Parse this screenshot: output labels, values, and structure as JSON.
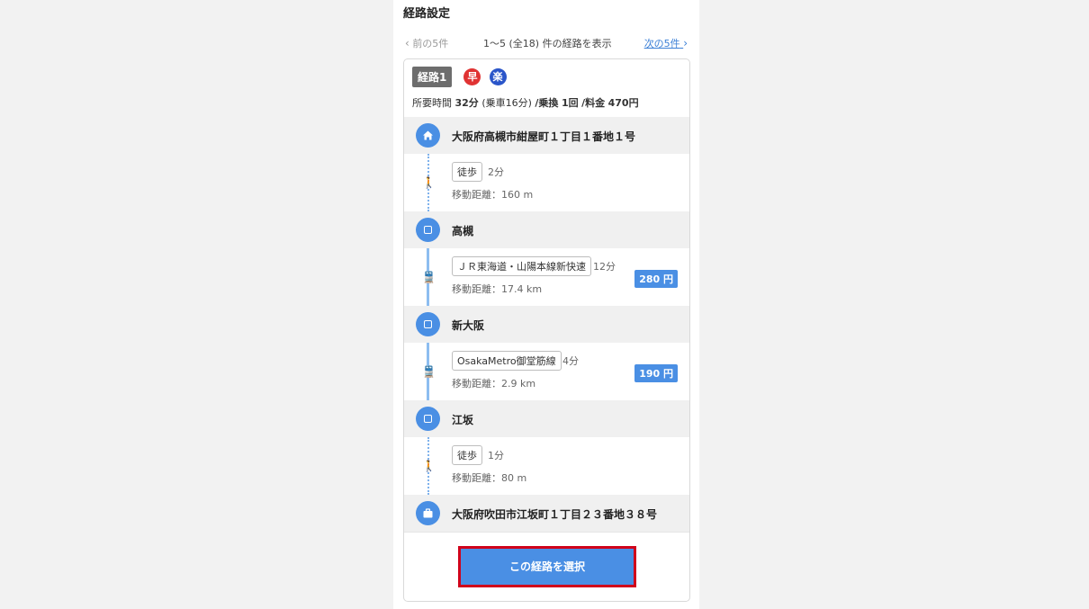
{
  "header": {
    "title": "経路設定"
  },
  "pager": {
    "prev_label": "前の5件",
    "summary": "1〜5 (全18) 件の経路を表示",
    "next_label": "次の5件"
  },
  "route": {
    "label": "経路1",
    "badges": {
      "fast": "早",
      "easy": "楽"
    },
    "summary": {
      "time_label": "所要時間",
      "time": "32分",
      "ride": "(乗車16分)",
      "transfer_label": "/乗換",
      "transfer": "1回",
      "fare_label": "/料金",
      "fare": "470円"
    }
  },
  "stations": [
    {
      "name": "大阪府高槻市紺屋町１丁目１番地１号",
      "icon": "home-icon"
    },
    {
      "name": "高槻",
      "icon": "station-icon"
    },
    {
      "name": "新大阪",
      "icon": "station-icon"
    },
    {
      "name": "江坂",
      "icon": "station-icon"
    },
    {
      "name": "大阪府吹田市江坂町１丁目２３番地３８号",
      "icon": "briefcase-icon"
    }
  ],
  "segments": [
    {
      "mode": "walk",
      "tag": "徒歩",
      "duration": "2分",
      "distance": "移動距離：160 m",
      "fare": ""
    },
    {
      "mode": "train",
      "tag": "ＪＲ東海道・山陽本線新快速",
      "duration": "12分",
      "distance": "移動距離：17.4 km",
      "fare": "280 円"
    },
    {
      "mode": "train",
      "tag": "OsakaMetro御堂筋線",
      "duration": "4分",
      "distance": "移動距離：2.9 km",
      "fare": "190 円"
    },
    {
      "mode": "walk",
      "tag": "徒歩",
      "duration": "1分",
      "distance": "移動距離：80 m",
      "fare": ""
    }
  ],
  "actions": {
    "select_label": "この経路を選択"
  },
  "colors": {
    "accent": "#4a8fe4",
    "highlight_border": "#d0021b",
    "fast_badge": "#e03333",
    "easy_badge": "#2a55c9"
  }
}
